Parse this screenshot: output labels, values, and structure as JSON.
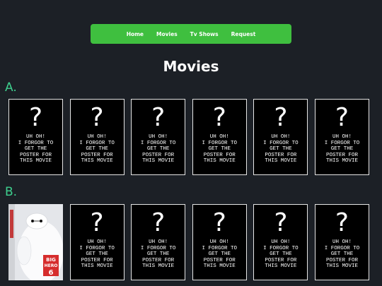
{
  "nav": {
    "items": [
      "Home",
      "Movies",
      "Tv Shows",
      "Request"
    ]
  },
  "page_title": "Movies",
  "sections": [
    {
      "label": "A."
    },
    {
      "label": "B."
    }
  ],
  "card": {
    "qmark": "?",
    "missing_text": "UH OH!\nI FORGOR TO\nGET THE\nPOSTER FOR\nTHIS MOVIE"
  },
  "poster": {
    "title_lines": [
      "BIG",
      "HERO",
      "6"
    ]
  },
  "colors": {
    "background": "#1c2026",
    "navbar": "#3fbf3f",
    "section_label": "#3ecf8e"
  }
}
